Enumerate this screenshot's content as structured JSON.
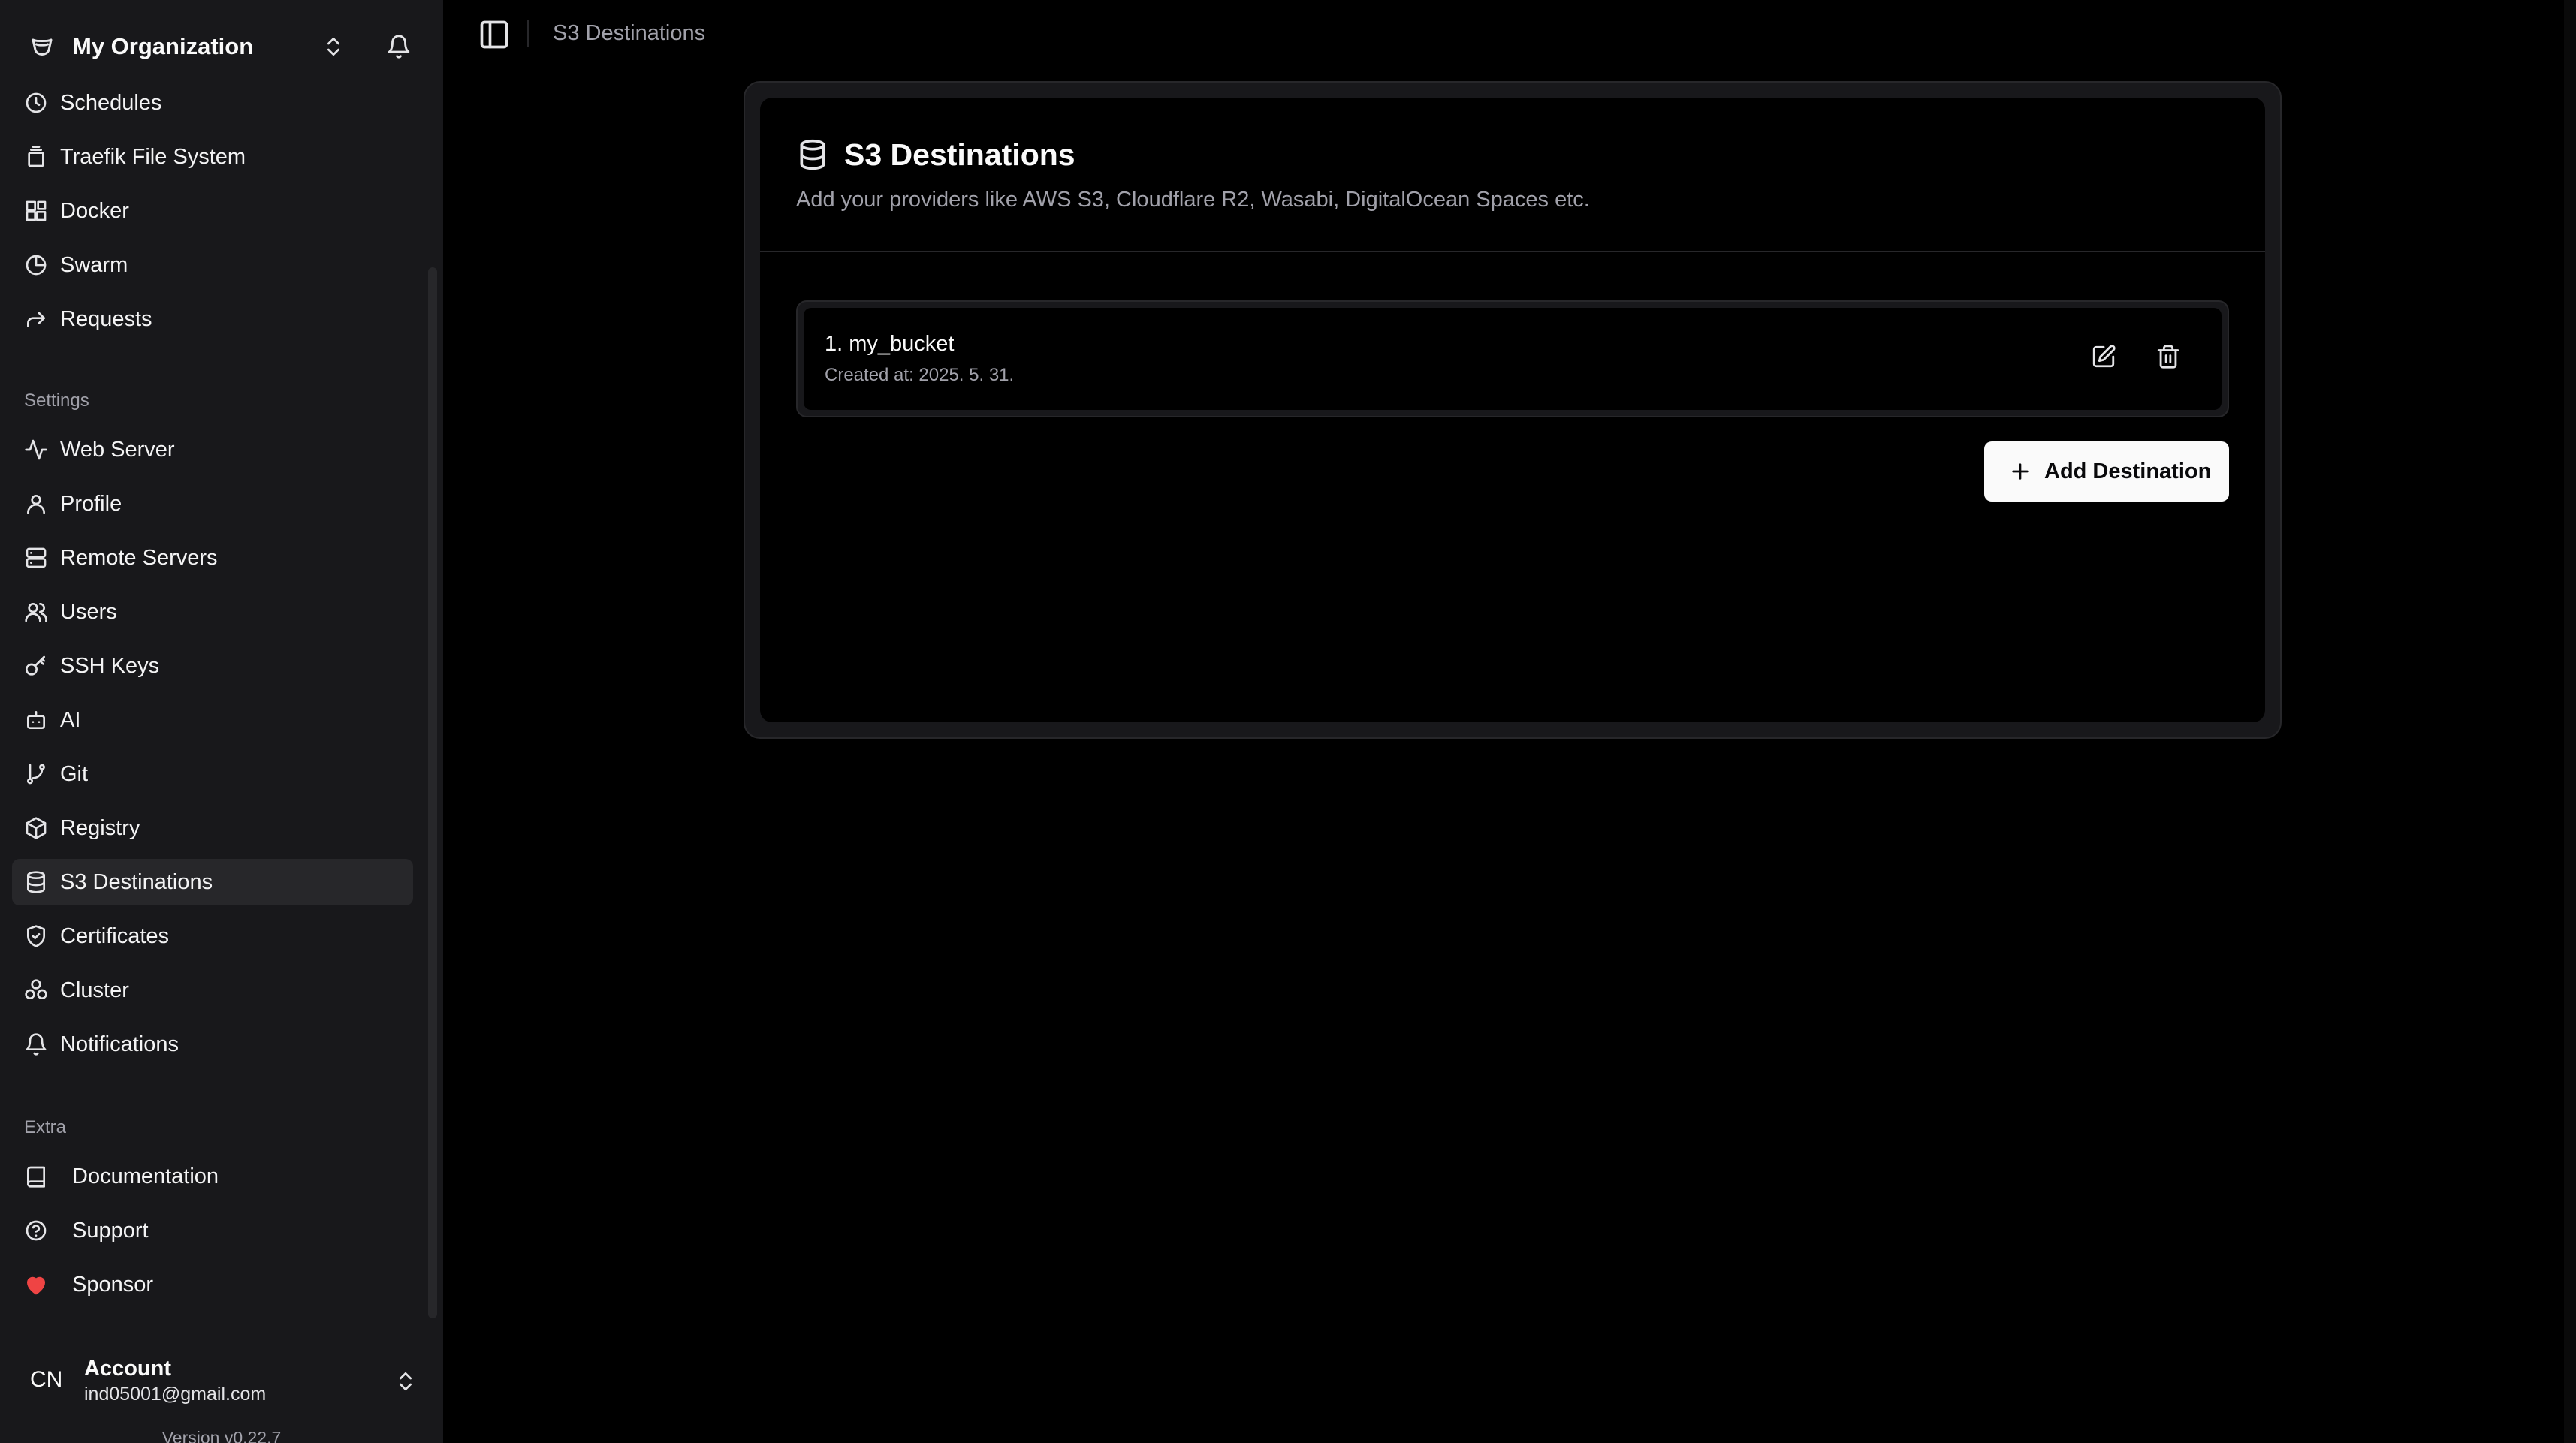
{
  "org": {
    "name": "My Organization"
  },
  "sidebar": {
    "top_items": [
      {
        "label": "Schedules",
        "icon": "clock-icon"
      },
      {
        "label": "Traefik File System",
        "icon": "file-stack-icon"
      },
      {
        "label": "Docker",
        "icon": "blocks-icon"
      },
      {
        "label": "Swarm",
        "icon": "pie-chart-icon"
      },
      {
        "label": "Requests",
        "icon": "forward-arrow-icon"
      }
    ],
    "settings_label": "Settings",
    "settings_items": [
      {
        "label": "Web Server",
        "icon": "activity-icon"
      },
      {
        "label": "Profile",
        "icon": "user-icon"
      },
      {
        "label": "Remote Servers",
        "icon": "server-icon"
      },
      {
        "label": "Users",
        "icon": "users-icon"
      },
      {
        "label": "SSH Keys",
        "icon": "key-icon"
      },
      {
        "label": "AI",
        "icon": "bot-icon"
      },
      {
        "label": "Git",
        "icon": "git-branch-icon"
      },
      {
        "label": "Registry",
        "icon": "package-icon"
      },
      {
        "label": "S3 Destinations",
        "icon": "database-icon",
        "active": true
      },
      {
        "label": "Certificates",
        "icon": "shield-check-icon"
      },
      {
        "label": "Cluster",
        "icon": "boxes-icon"
      },
      {
        "label": "Notifications",
        "icon": "bell-icon"
      }
    ],
    "extra_label": "Extra",
    "extra_items": [
      {
        "label": "Documentation",
        "icon": "book-icon"
      },
      {
        "label": "Support",
        "icon": "help-circle-icon"
      },
      {
        "label": "Sponsor",
        "icon": "heart-icon"
      }
    ]
  },
  "account": {
    "initials": "CN",
    "title": "Account",
    "email": "ind05001@gmail.com",
    "version": "Version v0.22.7"
  },
  "topbar": {
    "breadcrumb": "S3 Destinations"
  },
  "card": {
    "title": "S3 Destinations",
    "description": "Add your providers like AWS S3, Cloudflare R2, Wasabi, DigitalOcean Spaces etc."
  },
  "destinations": [
    {
      "name": "1. my_bucket",
      "created": "Created at: 2025. 5. 31."
    }
  ],
  "add_button": {
    "label": "Add Destination"
  },
  "colors": {
    "sponsor_heart": "#ef4444",
    "active_bg": "#27272a",
    "button_bg": "#fafafa"
  }
}
